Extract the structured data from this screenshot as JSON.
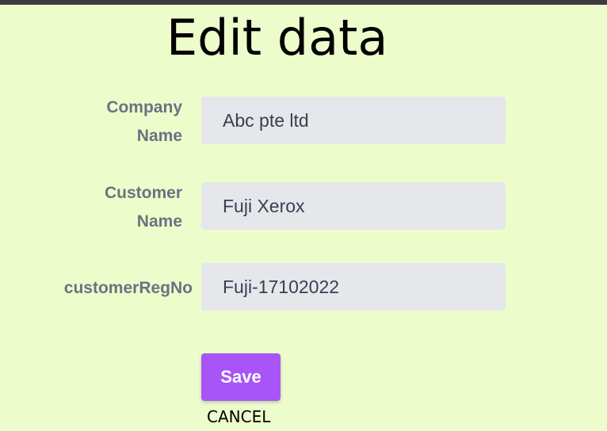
{
  "page": {
    "title": "Edit data"
  },
  "form": {
    "fields": [
      {
        "label_line1": "Company",
        "label_line2": "Name",
        "value": "Abc pte ltd"
      },
      {
        "label_line1": "Customer",
        "label_line2": "Name",
        "value": "Fuji Xerox"
      },
      {
        "label": "customerRegNo",
        "value": "Fuji-17102022"
      }
    ],
    "save_label": "Save",
    "cancel_label": "CANCEL"
  },
  "colors": {
    "background": "#edfccb",
    "field_background": "#e5e7eb",
    "label_text": "#6b7280",
    "save_button": "#a855f7"
  }
}
